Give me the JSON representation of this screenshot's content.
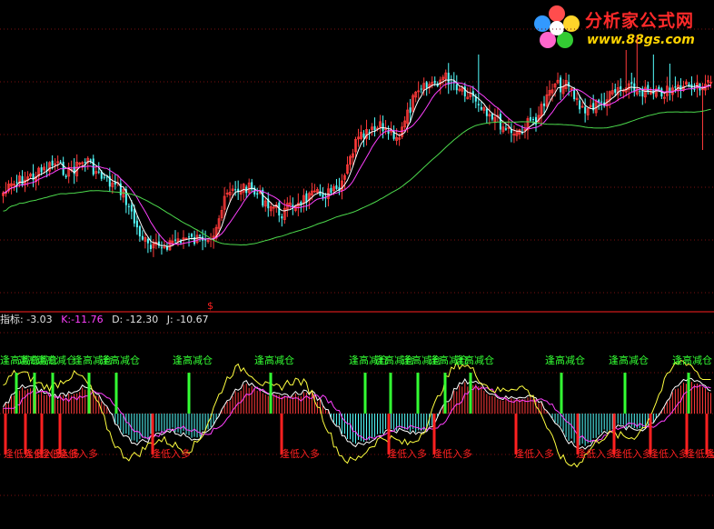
{
  "watermark": {
    "name": "分析家公式网",
    "url": "www.88gs.com"
  },
  "indicator_bar": {
    "name_label": "指标:",
    "name_value": "-3.03",
    "k_label": "K:",
    "k_value": "-11.76",
    "d_label": "D:",
    "d_value": "-12.30",
    "j_label": "J:",
    "j_value": "-10.67"
  },
  "colors": {
    "background": "#000000",
    "up": "#ff3a3a",
    "down": "#54ffff",
    "ma_fast": "#ffffff",
    "ma_mid": "#ff40ff",
    "ma_slow": "#4cd94c",
    "k_line": "#ffffff",
    "d_line": "#ff40ff",
    "j_line": "#ffff40",
    "sell_signal": "#33ff33",
    "buy_signal": "#ff2020",
    "separator": "#ff2020"
  },
  "icons": {
    "watermark_logo": "flower-logo-icon",
    "price_axis_marker": "dollar-icon"
  },
  "chart_data": [
    {
      "type": "candlestick",
      "panel": "price",
      "grid": true,
      "candle_count": 260,
      "moving_averages": [
        "fast",
        "mid",
        "slow"
      ]
    },
    {
      "type": "bar",
      "panel": "indicator",
      "grid": true,
      "bar_count": 260,
      "lines": [
        "K",
        "D",
        "J"
      ],
      "annotations": {
        "sell_label": "逢高减仓",
        "buy_label": "逢低入多",
        "sell_count": 15,
        "buy_count": 15
      }
    }
  ]
}
